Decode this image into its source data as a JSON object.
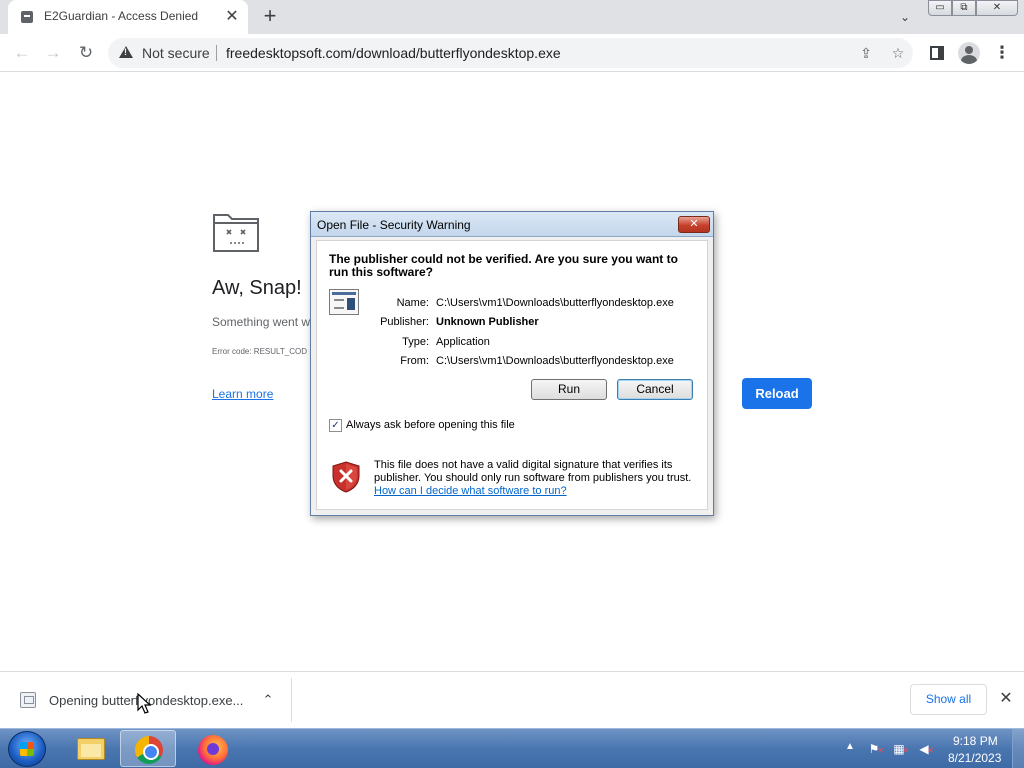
{
  "browser": {
    "tab": {
      "title": "E2Guardian - Access Denied",
      "close": "✕"
    },
    "new_tab": "+",
    "tab_search": "⌄",
    "window_controls": {
      "minimize": "▭",
      "maximize": "⧉",
      "close": "✕"
    },
    "toolbar": {
      "back": "←",
      "forward": "→",
      "reload": "↻",
      "security_label": "Not secure",
      "url": "freedesktopsoft.com/download/butterflyondesktop.exe",
      "share": "⇪",
      "bookmark": "☆",
      "menu": "⋮"
    }
  },
  "error_page": {
    "title": "Aw, Snap!",
    "description": "Something went w",
    "error_code": "Error code: RESULT_COD",
    "learn_more": "Learn more",
    "reload": "Reload"
  },
  "dialog": {
    "title": "Open File - Security Warning",
    "close": "✕",
    "heading": "The publisher could not be verified.  Are you sure you want to run this software?",
    "properties": [
      {
        "label": "Name:",
        "value": "C:\\Users\\vm1\\Downloads\\butterflyondesktop.exe",
        "bold": false
      },
      {
        "label": "Publisher:",
        "value": "Unknown Publisher",
        "bold": true
      },
      {
        "label": "Type:",
        "value": "Application",
        "bold": false
      },
      {
        "label": "From:",
        "value": "C:\\Users\\vm1\\Downloads\\butterflyondesktop.exe",
        "bold": false
      }
    ],
    "run": "Run",
    "cancel": "Cancel",
    "checkbox_label": "Always ask before opening this file",
    "checkbox_checked": true,
    "checkmark": "✓",
    "warning_text": "This file does not have a valid digital signature that verifies its publisher.  You should only run software from publishers you trust.",
    "warning_link": "How can I decide what software to run?"
  },
  "download_shelf": {
    "item_text": "Opening butterflyondesktop.exe...",
    "chevron": "⌃",
    "show_all": "Show all",
    "close": "✕"
  },
  "taskbar": {
    "tray_arrow": "▲",
    "time": "9:18 PM",
    "date": "8/21/2023"
  },
  "colors": {
    "accent": "#1a73e8",
    "dialog_title_bg": "#c3d6ec",
    "taskbar": "#4a76b0"
  }
}
